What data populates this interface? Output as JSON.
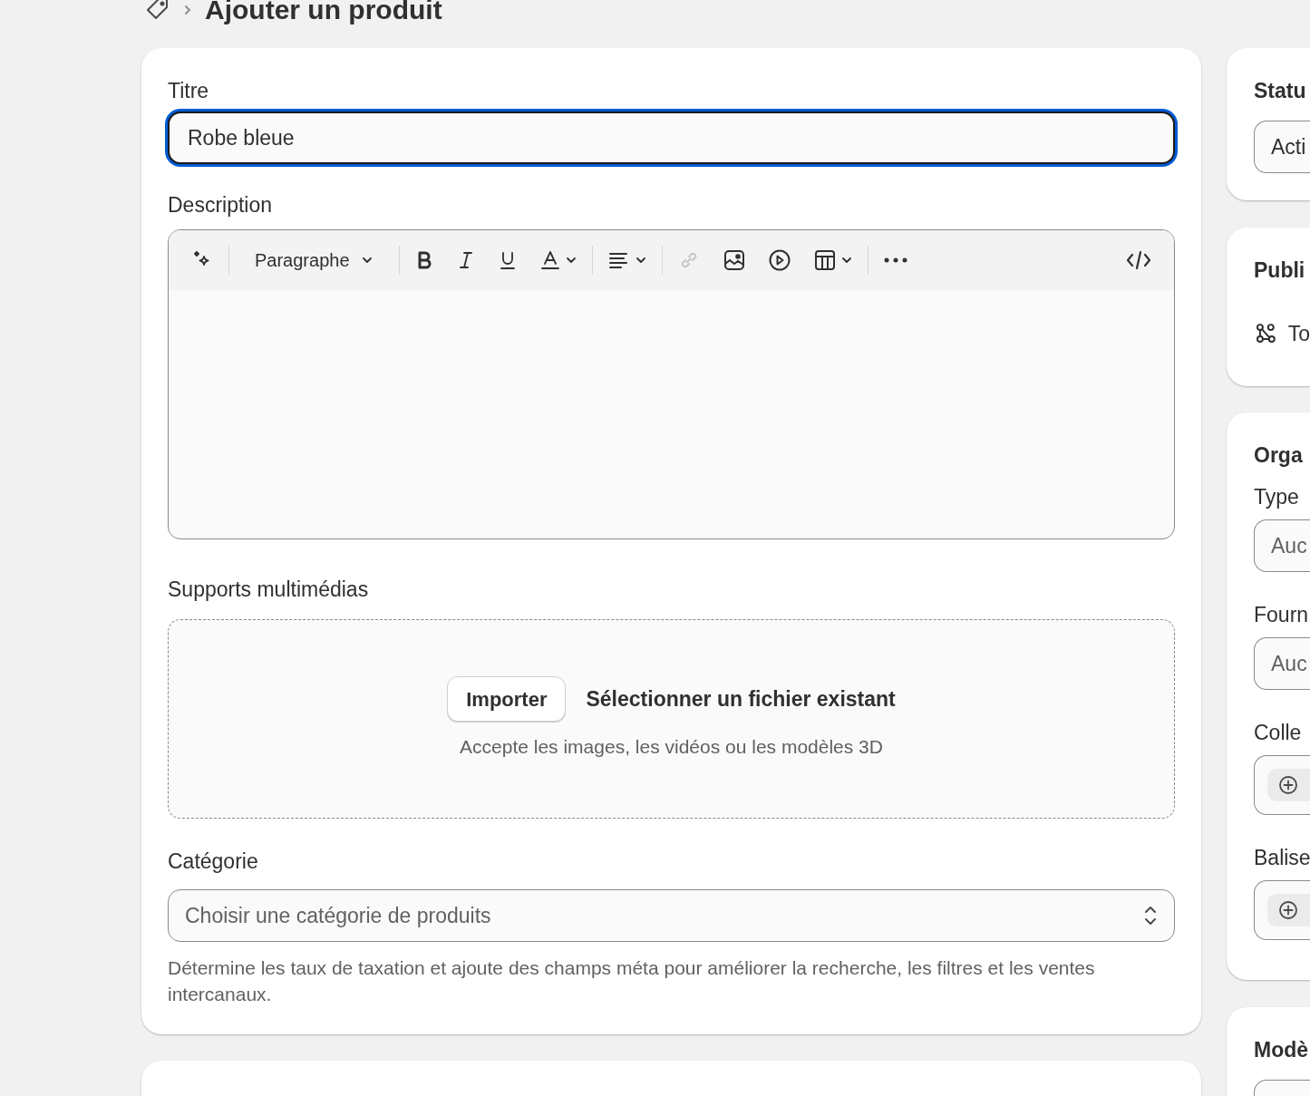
{
  "header": {
    "title": "Ajouter un produit"
  },
  "product": {
    "title_label": "Titre",
    "title_value": "Robe bleue",
    "title_focused": true,
    "description_label": "Description",
    "toolbar": {
      "format": "Paragraphe",
      "link_disabled": true
    },
    "media_label": "Supports multimédias",
    "upload_button": "Importer",
    "select_link": "Sélectionner un fichier existant",
    "media_hint": "Accepte les images, les vidéos ou les modèles 3D",
    "category_label": "Catégorie",
    "category_placeholder": "Choisir une catégorie de produits",
    "category_help": "Détermine les taux de taxation et ajoute des champs méta pour améliorer la recherche, les filtres et les ventes intercanaux."
  },
  "status_card": {
    "title": "Statu",
    "value": "Acti"
  },
  "publication_card": {
    "title": "Publi",
    "channel": "To"
  },
  "organization_card": {
    "title": "Orga",
    "fields": [
      {
        "kind": "text",
        "label": "Type",
        "placeholder": "Auc"
      },
      {
        "kind": "text",
        "label": "Fourn",
        "placeholder": "Auc"
      },
      {
        "kind": "tags",
        "label": "Colle"
      },
      {
        "kind": "tags",
        "label": "Balise"
      }
    ]
  },
  "template_card": {
    "title": "Modè"
  }
}
